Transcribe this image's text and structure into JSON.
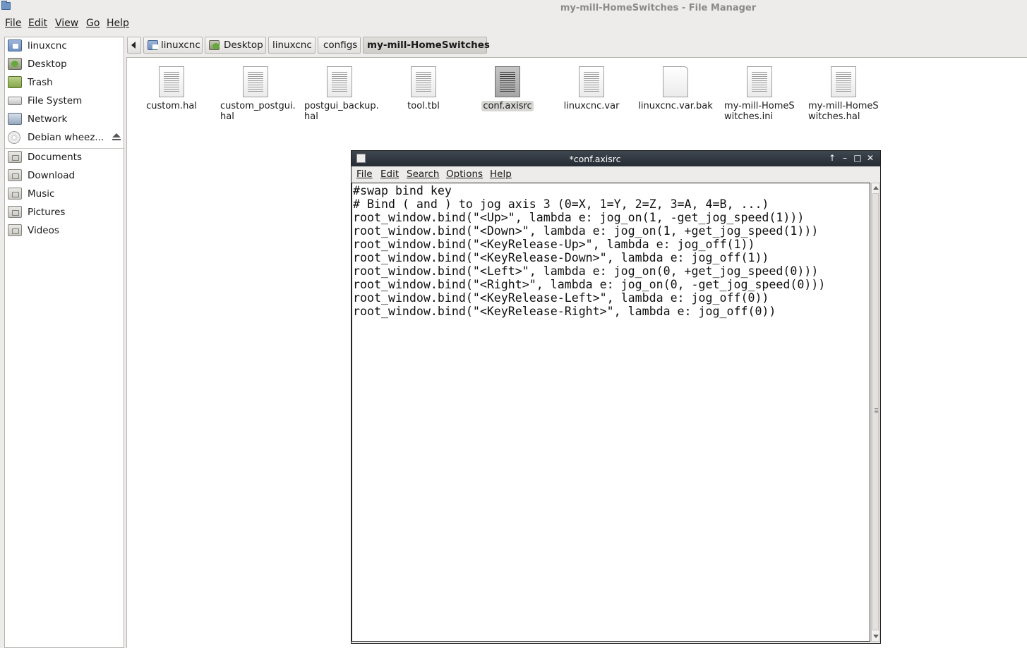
{
  "window": {
    "title": "my-mill-HomeSwitches - File Manager"
  },
  "menu": {
    "file": "File",
    "edit": "Edit",
    "view": "View",
    "go": "Go",
    "help": "Help"
  },
  "sidebar": {
    "items": [
      {
        "label": "linuxcnc",
        "icon": "home-folder-icon"
      },
      {
        "label": "Desktop",
        "icon": "desktop-icon"
      },
      {
        "label": "Trash",
        "icon": "trash-icon"
      },
      {
        "label": "File System",
        "icon": "drive-icon"
      },
      {
        "label": "Network",
        "icon": "network-icon"
      },
      {
        "label": "Debian wheez...",
        "icon": "disc-icon"
      }
    ],
    "bookmarks": [
      {
        "label": "Documents",
        "icon": "documents-folder-icon"
      },
      {
        "label": "Download",
        "icon": "download-folder-icon"
      },
      {
        "label": "Music",
        "icon": "music-folder-icon"
      },
      {
        "label": "Pictures",
        "icon": "pictures-folder-icon"
      },
      {
        "label": "Videos",
        "icon": "videos-folder-icon"
      }
    ]
  },
  "pathbar": {
    "crumbs": [
      "linuxcnc",
      "Desktop",
      "linuxcnc",
      "configs",
      "my-mill-HomeSwitches"
    ]
  },
  "files": [
    {
      "name": "custom.hal"
    },
    {
      "name": "custom_postgui.hal"
    },
    {
      "name": "postgui_backup.hal"
    },
    {
      "name": "tool.tbl"
    },
    {
      "name": "conf.axisrc"
    },
    {
      "name": "linuxcnc.var"
    },
    {
      "name": "linuxcnc.var.bak"
    },
    {
      "name": "my-mill-HomeSwitches.ini"
    },
    {
      "name": "my-mill-HomeSwitches.hal"
    }
  ],
  "editor": {
    "title": "*conf.axisrc",
    "menu": {
      "file": "File",
      "edit": "Edit",
      "search": "Search",
      "options": "Options",
      "help": "Help"
    },
    "lines": [
      "#swap bind key",
      "# Bind ( and ) to jog axis 3 (0=X, 1=Y, 2=Z, 3=A, 4=B, ...)",
      "root_window.bind(\"<Up>\", lambda e: jog_on(1, -get_jog_speed(1)))",
      "root_window.bind(\"<Down>\", lambda e: jog_on(1, +get_jog_speed(1)))",
      "root_window.bind(\"<KeyRelease-Up>\", lambda e: jog_off(1))",
      "root_window.bind(\"<KeyRelease-Down>\", lambda e: jog_off(1))",
      "root_window.bind(\"<Left>\", lambda e: jog_on(0, +get_jog_speed(0)))",
      "root_window.bind(\"<Right>\", lambda e: jog_on(0, -get_jog_speed(0)))",
      "root_window.bind(\"<KeyRelease-Left>\", lambda e: jog_off(0))",
      "root_window.bind(\"<KeyRelease-Right>\", lambda e: jog_off(0))"
    ]
  }
}
